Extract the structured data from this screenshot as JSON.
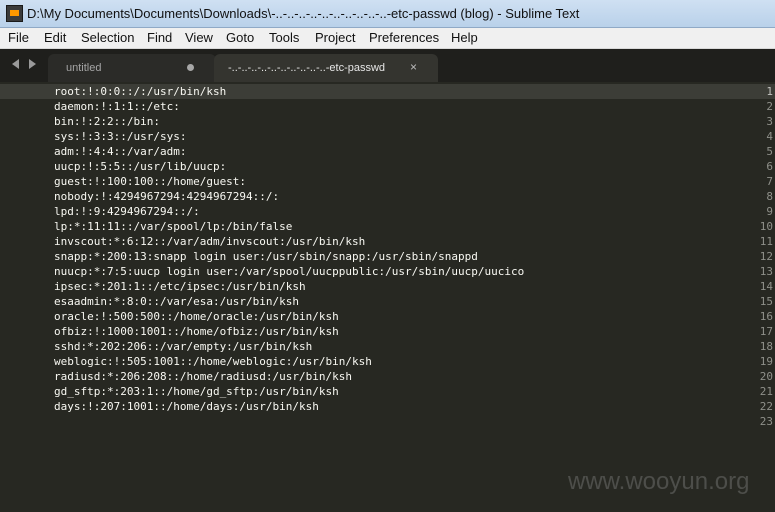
{
  "window": {
    "title": "D:\\My Documents\\Documents\\Downloads\\-..-..-..-..-..-..-..-..-..-..-etc-passwd (blog) - Sublime Text"
  },
  "menu": [
    "File",
    "Edit",
    "Selection",
    "Find",
    "View",
    "Goto",
    "Tools",
    "Project",
    "Preferences",
    "Help"
  ],
  "tabs": [
    {
      "label": "untitled",
      "dirty": true
    },
    {
      "label": "-..-..-..-..-..-..-..-..-..-..-etc-passwd",
      "close": "×"
    }
  ],
  "editor": {
    "active_line": 1,
    "lines": [
      "root:!:0:0::/:/usr/bin/ksh",
      "daemon:!:1:1::/etc:",
      "bin:!:2:2::/bin:",
      "sys:!:3:3::/usr/sys:",
      "adm:!:4:4::/var/adm:",
      "uucp:!:5:5::/usr/lib/uucp:",
      "guest:!:100:100::/home/guest:",
      "nobody:!:4294967294:4294967294::/:",
      "lpd:!:9:4294967294::/:",
      "lp:*:11:11::/var/spool/lp:/bin/false",
      "invscout:*:6:12::/var/adm/invscout:/usr/bin/ksh",
      "snapp:*:200:13:snapp login user:/usr/sbin/snapp:/usr/sbin/snappd",
      "nuucp:*:7:5:uucp login user:/var/spool/uucppublic:/usr/sbin/uucp/uucico",
      "ipsec:*:201:1::/etc/ipsec:/usr/bin/ksh",
      "esaadmin:*:8:0::/var/esa:/usr/bin/ksh",
      "oracle:!:500:500::/home/oracle:/usr/bin/ksh",
      "ofbiz:!:1000:1001::/home/ofbiz:/usr/bin/ksh",
      "sshd:*:202:206::/var/empty:/usr/bin/ksh",
      "weblogic:!:505:1001::/home/weblogic:/usr/bin/ksh",
      "radiusd:*:206:208::/home/radiusd:/usr/bin/ksh",
      "gd_sftp:*:203:1::/home/gd_sftp:/usr/bin/ksh",
      "days:!:207:1001::/home/days:/usr/bin/ksh",
      ""
    ]
  },
  "watermark": "www.wooyun.org",
  "colors": {
    "editor_bg": "#272822",
    "text": "#f8f8f2",
    "gutter_text": "#8f908a"
  }
}
